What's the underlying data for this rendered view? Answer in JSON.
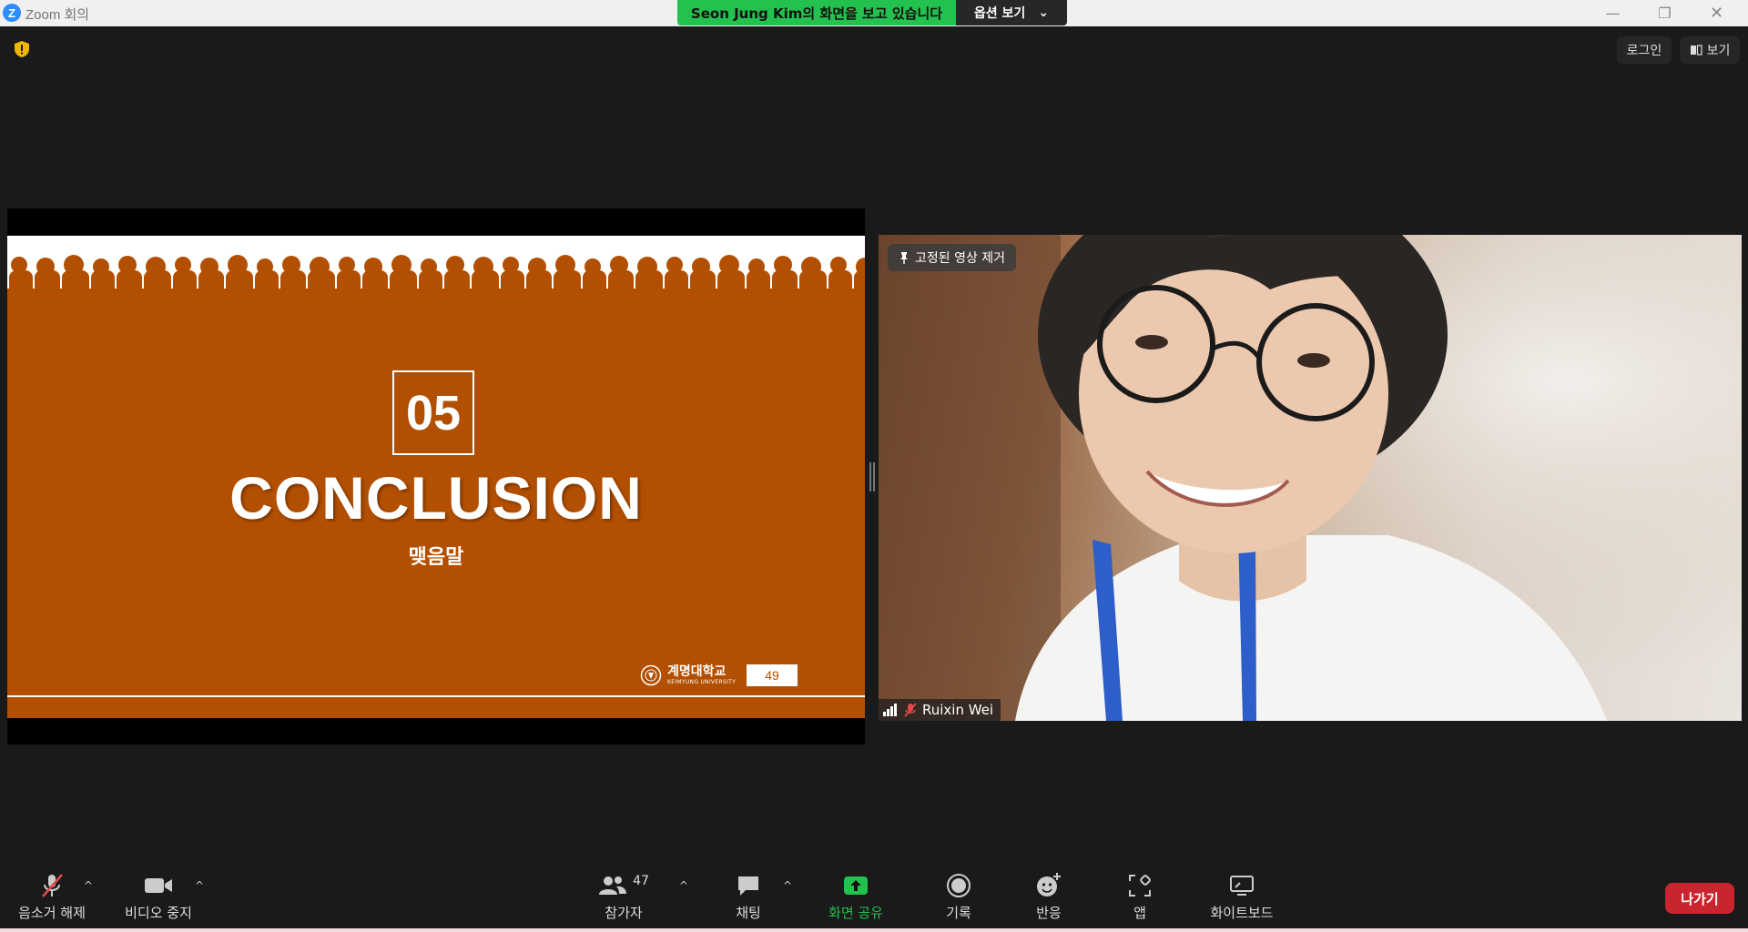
{
  "window": {
    "app_letter": "Z",
    "title": "Zoom 회의",
    "minimize": "—",
    "restore": "❐",
    "close": "✕"
  },
  "banner": {
    "viewing_text": "Seon Jung Kim의 화면을 보고 있습니다",
    "options_label": "옵션 보기",
    "options_chevron": "⌄"
  },
  "top_right": {
    "login_label": "로그인",
    "view_label": "보기"
  },
  "slide": {
    "number": "05",
    "title": "CONCLUSION",
    "subtitle": "맺음말",
    "university_ko": "계명대학교",
    "university_en": "KEIMYUNG UNIVERSITY",
    "page_number": "49"
  },
  "video": {
    "unpin_label": "고정된 영상 제거",
    "participant_name": "Ruixin Wei"
  },
  "toolbar": {
    "unmute_label": "음소거 해제",
    "video_label": "비디오 중지",
    "participants_label": "참가자",
    "participants_count": "47",
    "chat_label": "채팅",
    "share_label": "화면 공유",
    "record_label": "기록",
    "reactions_label": "반응",
    "apps_label": "앱",
    "whiteboard_label": "화이트보드",
    "leave_label": "나가기",
    "caret": "^"
  },
  "colors": {
    "slide_bg": "#b34f00",
    "banner_green": "#23c14d",
    "share_green": "#23c14d",
    "leave_red": "#c9252f",
    "zoom_blue": "#2d8cff"
  }
}
